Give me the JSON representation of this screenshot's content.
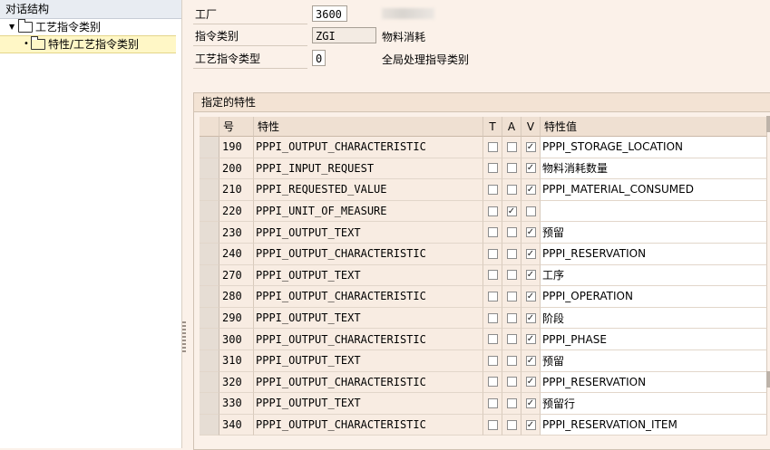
{
  "tree": {
    "header": "对话结构",
    "root": "工艺指令类别",
    "child": "特性/工艺指令类别"
  },
  "header_fields": {
    "plant": {
      "label": "工厂",
      "value": "3600"
    },
    "category": {
      "label": "指令类别",
      "value": "ZGI",
      "desc": "物料消耗"
    },
    "category_type": {
      "label": "工艺指令类型",
      "value": "0",
      "desc": "全局处理指导类别"
    }
  },
  "section": {
    "title": "指定的特性",
    "columns": {
      "no": "号",
      "char": "特性",
      "t": "T",
      "a": "A",
      "v": "V",
      "value": "特性值"
    },
    "rows": [
      {
        "no": "190",
        "char": "PPPI_OUTPUT_CHARACTERISTIC",
        "t": false,
        "a": false,
        "v": true,
        "value": "PPPI_STORAGE_LOCATION"
      },
      {
        "no": "200",
        "char": "PPPI_INPUT_REQUEST",
        "t": false,
        "a": false,
        "v": true,
        "value": "物料消耗数量"
      },
      {
        "no": "210",
        "char": "PPPI_REQUESTED_VALUE",
        "t": false,
        "a": false,
        "v": true,
        "value": "PPPI_MATERIAL_CONSUMED"
      },
      {
        "no": "220",
        "char": "PPPI_UNIT_OF_MEASURE",
        "t": false,
        "a": true,
        "v": false,
        "value": ""
      },
      {
        "no": "230",
        "char": "PPPI_OUTPUT_TEXT",
        "t": false,
        "a": false,
        "v": true,
        "value": "预留"
      },
      {
        "no": "240",
        "char": "PPPI_OUTPUT_CHARACTERISTIC",
        "t": false,
        "a": false,
        "v": true,
        "value": "PPPI_RESERVATION"
      },
      {
        "no": "270",
        "char": "PPPI_OUTPUT_TEXT",
        "t": false,
        "a": false,
        "v": true,
        "value": "工序"
      },
      {
        "no": "280",
        "char": "PPPI_OUTPUT_CHARACTERISTIC",
        "t": false,
        "a": false,
        "v": true,
        "value": "PPPI_OPERATION"
      },
      {
        "no": "290",
        "char": "PPPI_OUTPUT_TEXT",
        "t": false,
        "a": false,
        "v": true,
        "value": "阶段"
      },
      {
        "no": "300",
        "char": "PPPI_OUTPUT_CHARACTERISTIC",
        "t": false,
        "a": false,
        "v": true,
        "value": "PPPI_PHASE"
      },
      {
        "no": "310",
        "char": "PPPI_OUTPUT_TEXT",
        "t": false,
        "a": false,
        "v": true,
        "value": "预留"
      },
      {
        "no": "320",
        "char": "PPPI_OUTPUT_CHARACTERISTIC",
        "t": false,
        "a": false,
        "v": true,
        "value": "PPPI_RESERVATION"
      },
      {
        "no": "330",
        "char": "PPPI_OUTPUT_TEXT",
        "t": false,
        "a": false,
        "v": true,
        "value": "预留行"
      },
      {
        "no": "340",
        "char": "PPPI_OUTPUT_CHARACTERISTIC",
        "t": false,
        "a": false,
        "v": true,
        "value": "PPPI_RESERVATION_ITEM"
      }
    ]
  }
}
